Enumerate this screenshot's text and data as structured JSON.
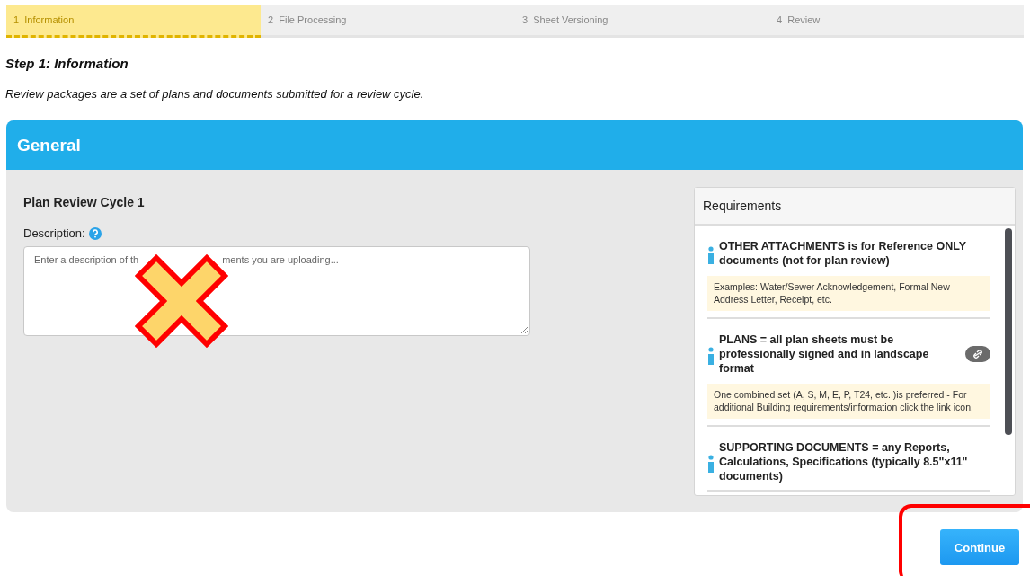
{
  "steps": [
    {
      "number": "1",
      "label": "Information",
      "selected": true
    },
    {
      "number": "2",
      "label": "File Processing",
      "selected": false
    },
    {
      "number": "3",
      "label": "Sheet Versioning",
      "selected": false
    },
    {
      "number": "4",
      "label": "Review",
      "selected": false
    }
  ],
  "heading": "Step 1: Information",
  "intro": "Review packages are a set of plans and documents submitted for a review cycle.",
  "panel": {
    "title": "General",
    "cycle_title": "Plan Review Cycle 1",
    "description_label": "Description:",
    "description_placeholder_parts": [
      "Enter a description of th",
      "ments you are uploading..."
    ],
    "requirements": {
      "title": "Requirements",
      "items": [
        {
          "title": "OTHER ATTACHMENTS is for Reference ONLY documents (not for plan review)",
          "note": "Examples: Water/Sewer Acknowledgement, Formal New Address Letter, Receipt, etc.",
          "link": false
        },
        {
          "title": "PLANS = all plan sheets must be professionally signed and in landscape format",
          "note": "One combined set (A, S, M, E, P, T24, etc. )is preferred - For additional Building requirements/information click the link icon.",
          "link": true
        },
        {
          "title": "SUPPORTING DOCUMENTS = any Reports, Calculations, Specifications (typically 8.5\"x11\" documents)",
          "link": false
        }
      ]
    }
  },
  "continue_button": "Continue"
}
